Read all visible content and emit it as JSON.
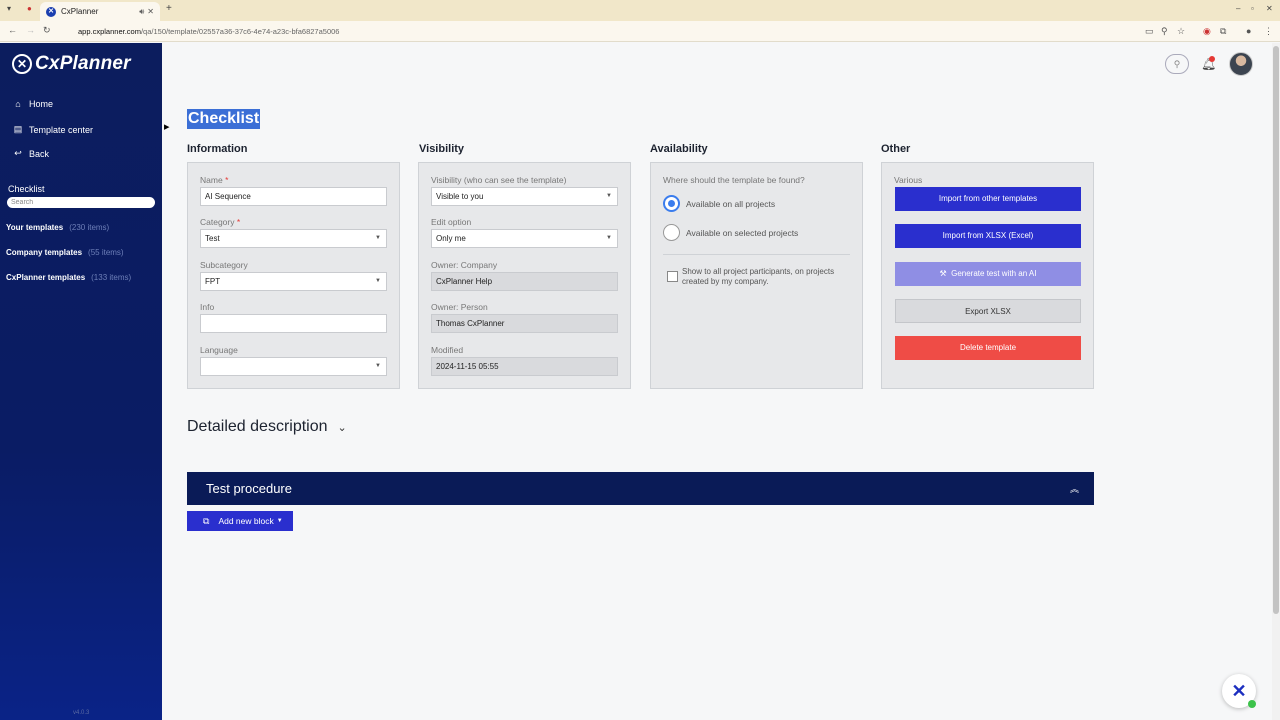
{
  "browser": {
    "tab_title": "CxPlanner",
    "url_host": "app.cxplanner.com",
    "url_path": "/qa/150/template/02557a36-37c6-4e74-a23c-bfa6827a5006"
  },
  "sidebar": {
    "logo": "CxPlanner",
    "nav": [
      {
        "label": "Home",
        "icon": "home-icon"
      },
      {
        "label": "Template center",
        "icon": "grid-icon"
      },
      {
        "label": "Back",
        "icon": "back-arrow-icon"
      }
    ],
    "section_label": "Checklist",
    "search_placeholder": "Search",
    "groups": [
      {
        "label": "Your templates",
        "count": "(230 items)"
      },
      {
        "label": "Company templates",
        "count": "(55 items)"
      },
      {
        "label": "CxPlanner templates",
        "count": "(133 items)"
      }
    ],
    "version": "v4.0.3"
  },
  "page": {
    "title": "Checklist"
  },
  "information": {
    "heading": "Information",
    "name_label": "Name",
    "name_value": "AI Sequence",
    "category_label": "Category",
    "category_value": "Test",
    "subcategory_label": "Subcategory",
    "subcategory_value": "FPT",
    "info_label": "Info",
    "info_value": "",
    "language_label": "Language",
    "language_value": ""
  },
  "visibility": {
    "heading": "Visibility",
    "visibility_label": "Visibility (who can see the template)",
    "visibility_value": "Visible to you",
    "edit_label": "Edit option",
    "edit_value": "Only me",
    "owner_company_label": "Owner: Company",
    "owner_company_value": "CxPlanner Help",
    "owner_person_label": "Owner: Person",
    "owner_person_value": "Thomas CxPlanner",
    "modified_label": "Modified",
    "modified_value": "2024-11-15 05:55"
  },
  "availability": {
    "heading": "Availability",
    "question": "Where should the template be found?",
    "option_all": "Available on all projects",
    "option_selected": "Available on selected projects",
    "show_all_label": "Show to all project participants, on projects created by my company."
  },
  "other": {
    "heading": "Other",
    "various_label": "Various",
    "import_templates": "Import from other templates",
    "import_xlsx": "Import from XLSX (Excel)",
    "generate_ai": "Generate test with an AI",
    "export_xlsx": "Export XLSX",
    "delete": "Delete template"
  },
  "detailed_description": "Detailed description",
  "procedure": {
    "title": "Test procedure",
    "add_block": "Add new block"
  },
  "colors": {
    "sidebar": "#0c1d5e",
    "primary_button": "#2a2fce",
    "danger_button": "#ef4c46",
    "procedure_header": "#0a1b57"
  }
}
